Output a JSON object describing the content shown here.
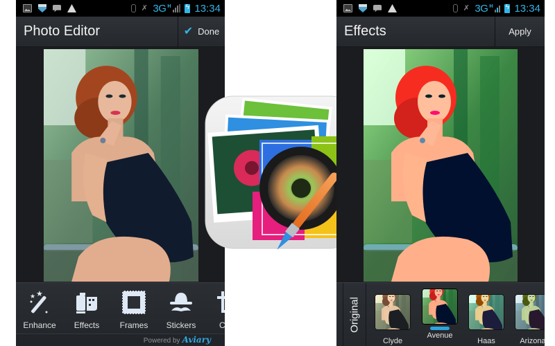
{
  "status_bar": {
    "network": "3G",
    "network_sub": "H",
    "time": "13:34",
    "left_icons": [
      "gallery-icon",
      "shield-icon",
      "chat-icon",
      "warning-icon"
    ],
    "right_icons": [
      "bluetooth-icon",
      "mute-icon",
      "signal-icon",
      "battery-icon"
    ]
  },
  "left_screen": {
    "title": "Photo Editor",
    "action_label": "Done",
    "action_icon": "checkmark-icon",
    "tools": [
      {
        "label": "Enhance",
        "icon": "magic-wand-icon"
      },
      {
        "label": "Effects",
        "icon": "film-roll-icon"
      },
      {
        "label": "Frames",
        "icon": "frame-icon"
      },
      {
        "label": "Stickers",
        "icon": "hat-mustache-icon"
      },
      {
        "label": "Crop",
        "icon": "crop-icon"
      }
    ],
    "powered_by": "Powered by",
    "brand": "Aviary"
  },
  "right_screen": {
    "title": "Effects",
    "action_label": "Apply",
    "original_label": "Original",
    "effects": [
      {
        "label": "Clyde",
        "selected": false
      },
      {
        "label": "Avenue",
        "selected": true
      },
      {
        "label": "Haas",
        "selected": false
      },
      {
        "label": "Arizona",
        "selected": false
      }
    ]
  },
  "colors": {
    "accent": "#33b5e5",
    "action_bar": "#2b2f34",
    "background": "#1b1c1f"
  }
}
